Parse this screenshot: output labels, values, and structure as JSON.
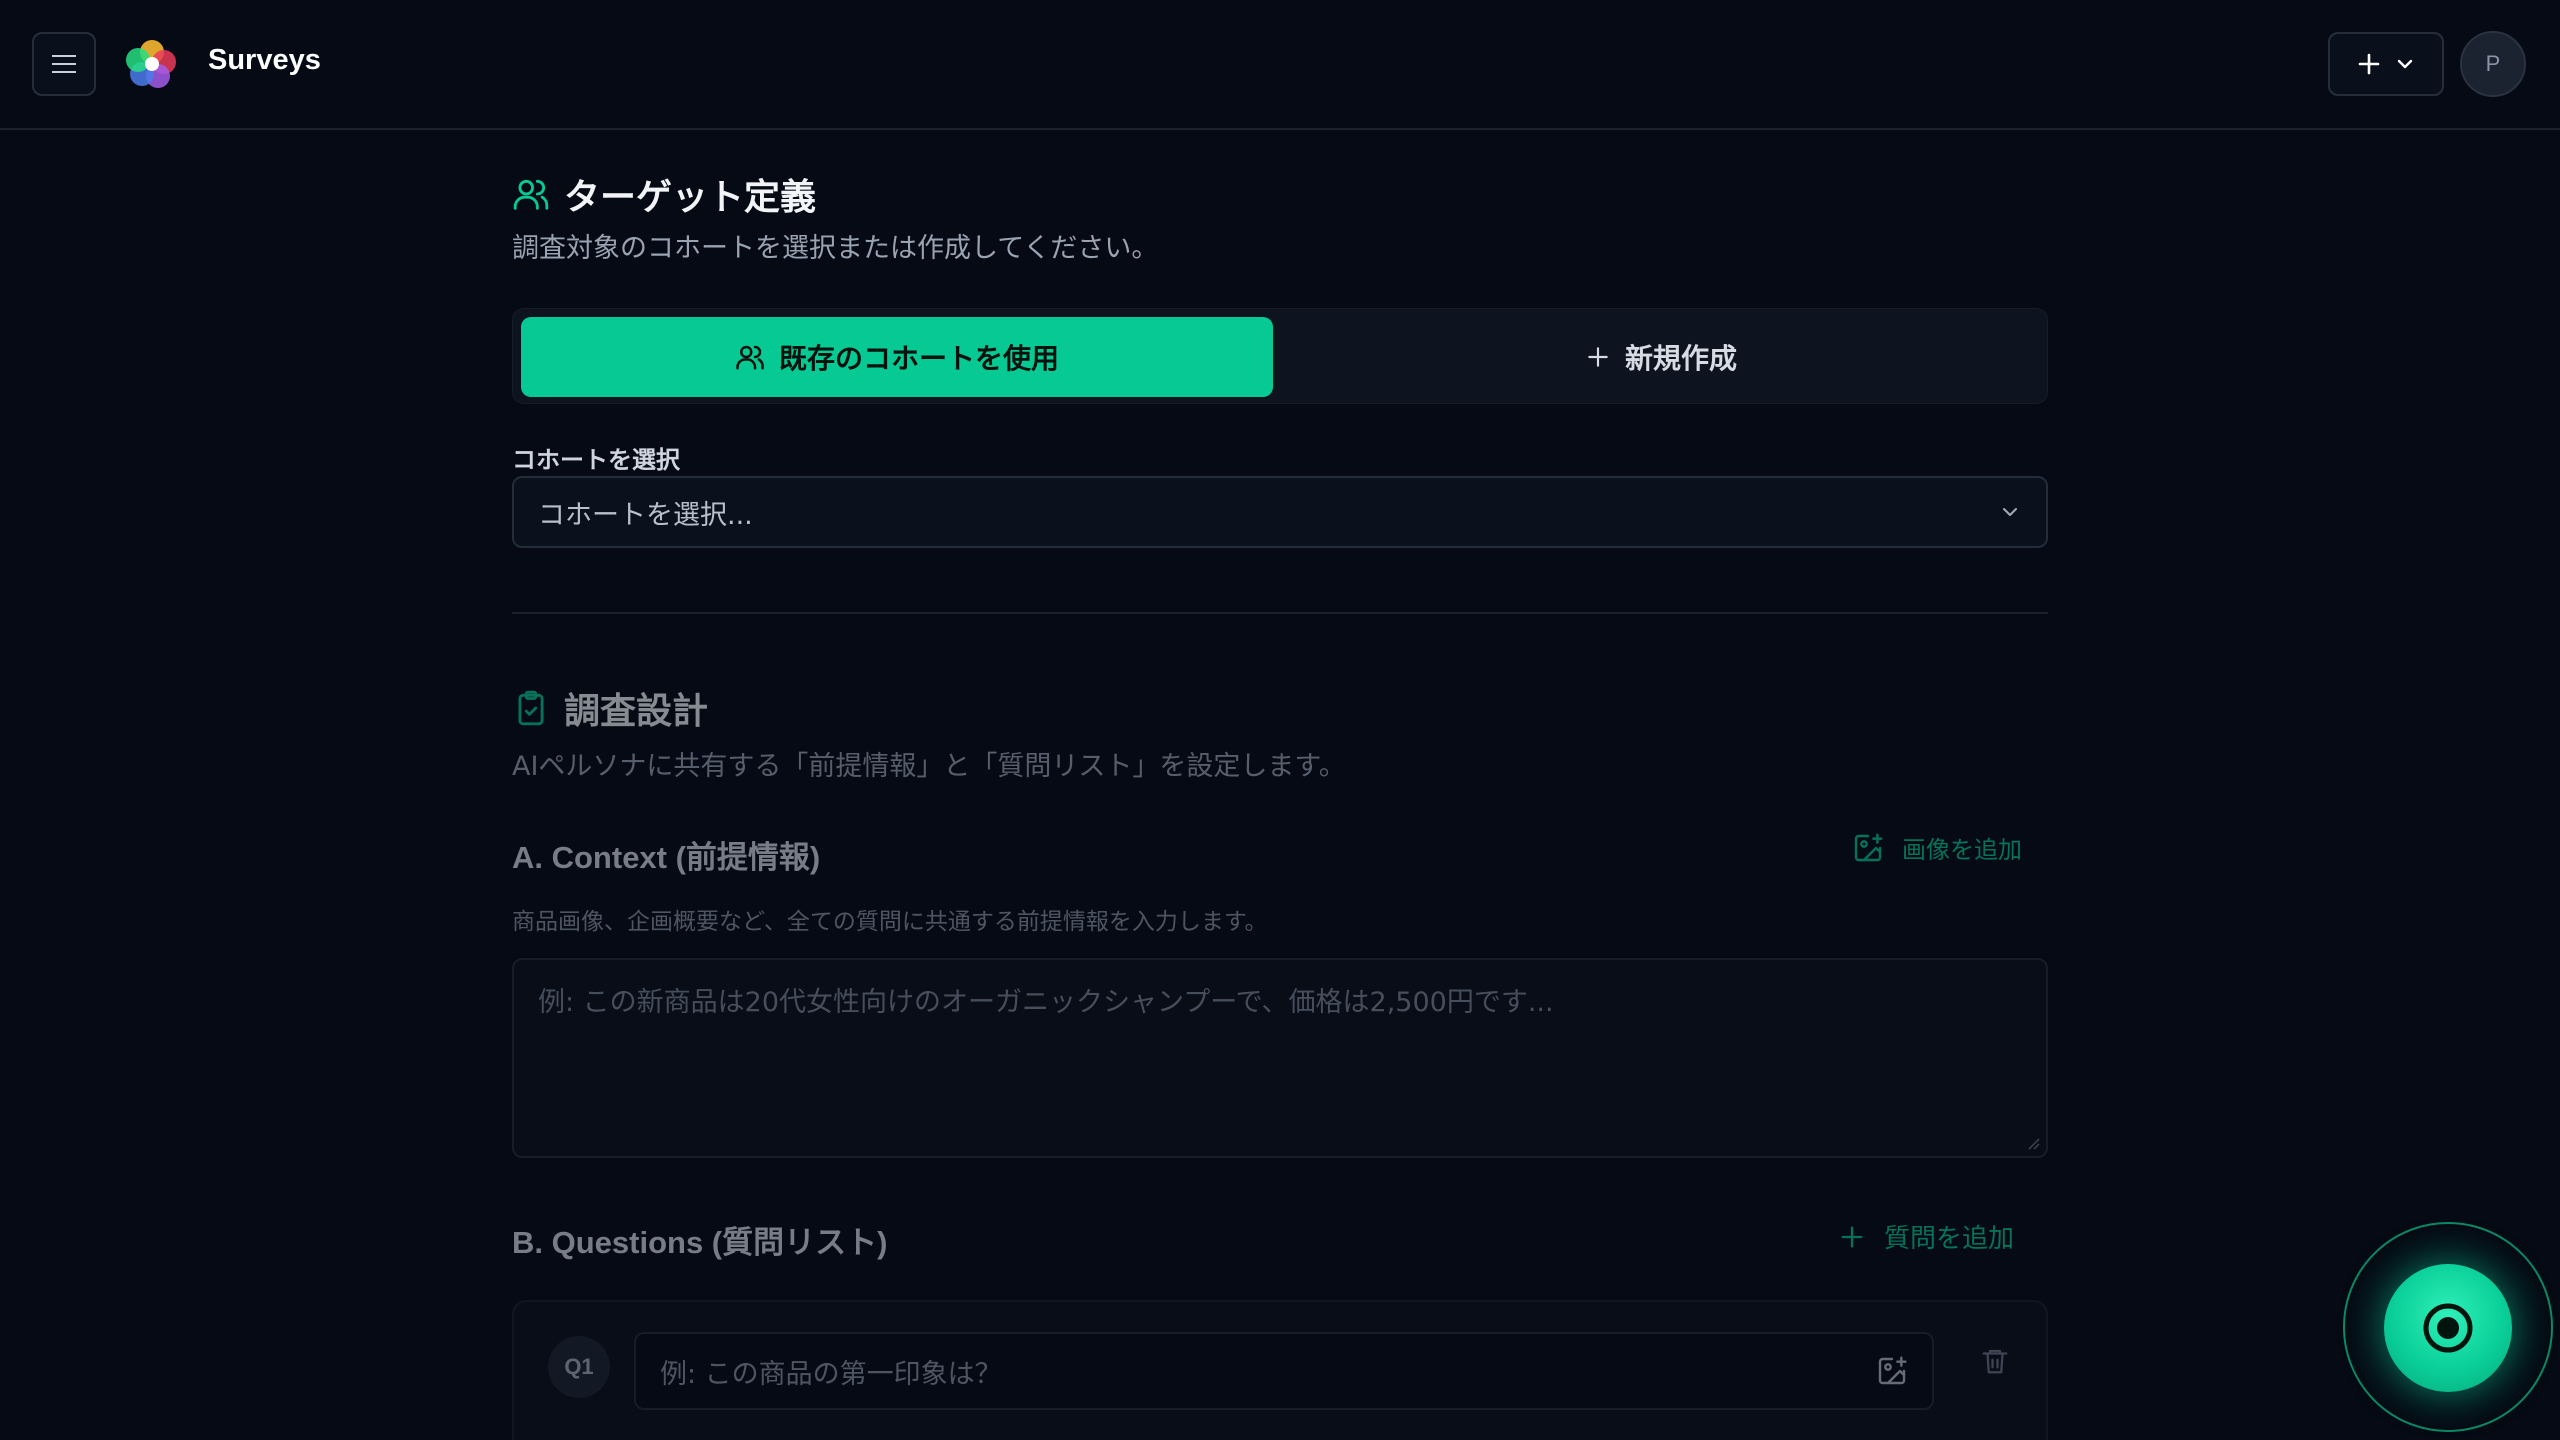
{
  "header": {
    "app_title": "Surveys",
    "avatar_initial": "P"
  },
  "target": {
    "title": "ターゲット定義",
    "description": "調査対象のコホートを選択または作成してください。",
    "toggle": {
      "existing_label": "既存のコホートを使用",
      "new_label": "新規作成"
    },
    "cohort_field_label": "コホートを選択",
    "cohort_select_placeholder": "コホートを選択..."
  },
  "design": {
    "title": "調査設計",
    "description": "AIペルソナに共有する「前提情報」と「質問リスト」を設定します。",
    "context": {
      "title": "A. Context (前提情報)",
      "add_image_label": "画像を追加",
      "description": "商品画像、企画概要など、全ての質問に共通する前提情報を入力します。",
      "placeholder": "例: この新商品は20代女性向けのオーガニックシャンプーで、価格は2,500円です..."
    },
    "questions": {
      "title": "B. Questions (質問リスト)",
      "add_question_label": "質問を追加",
      "items": [
        {
          "badge": "Q1",
          "placeholder": "例: この商品の第一印象は？"
        }
      ]
    }
  },
  "colors": {
    "accent": "#07c993",
    "background": "#050a14"
  }
}
